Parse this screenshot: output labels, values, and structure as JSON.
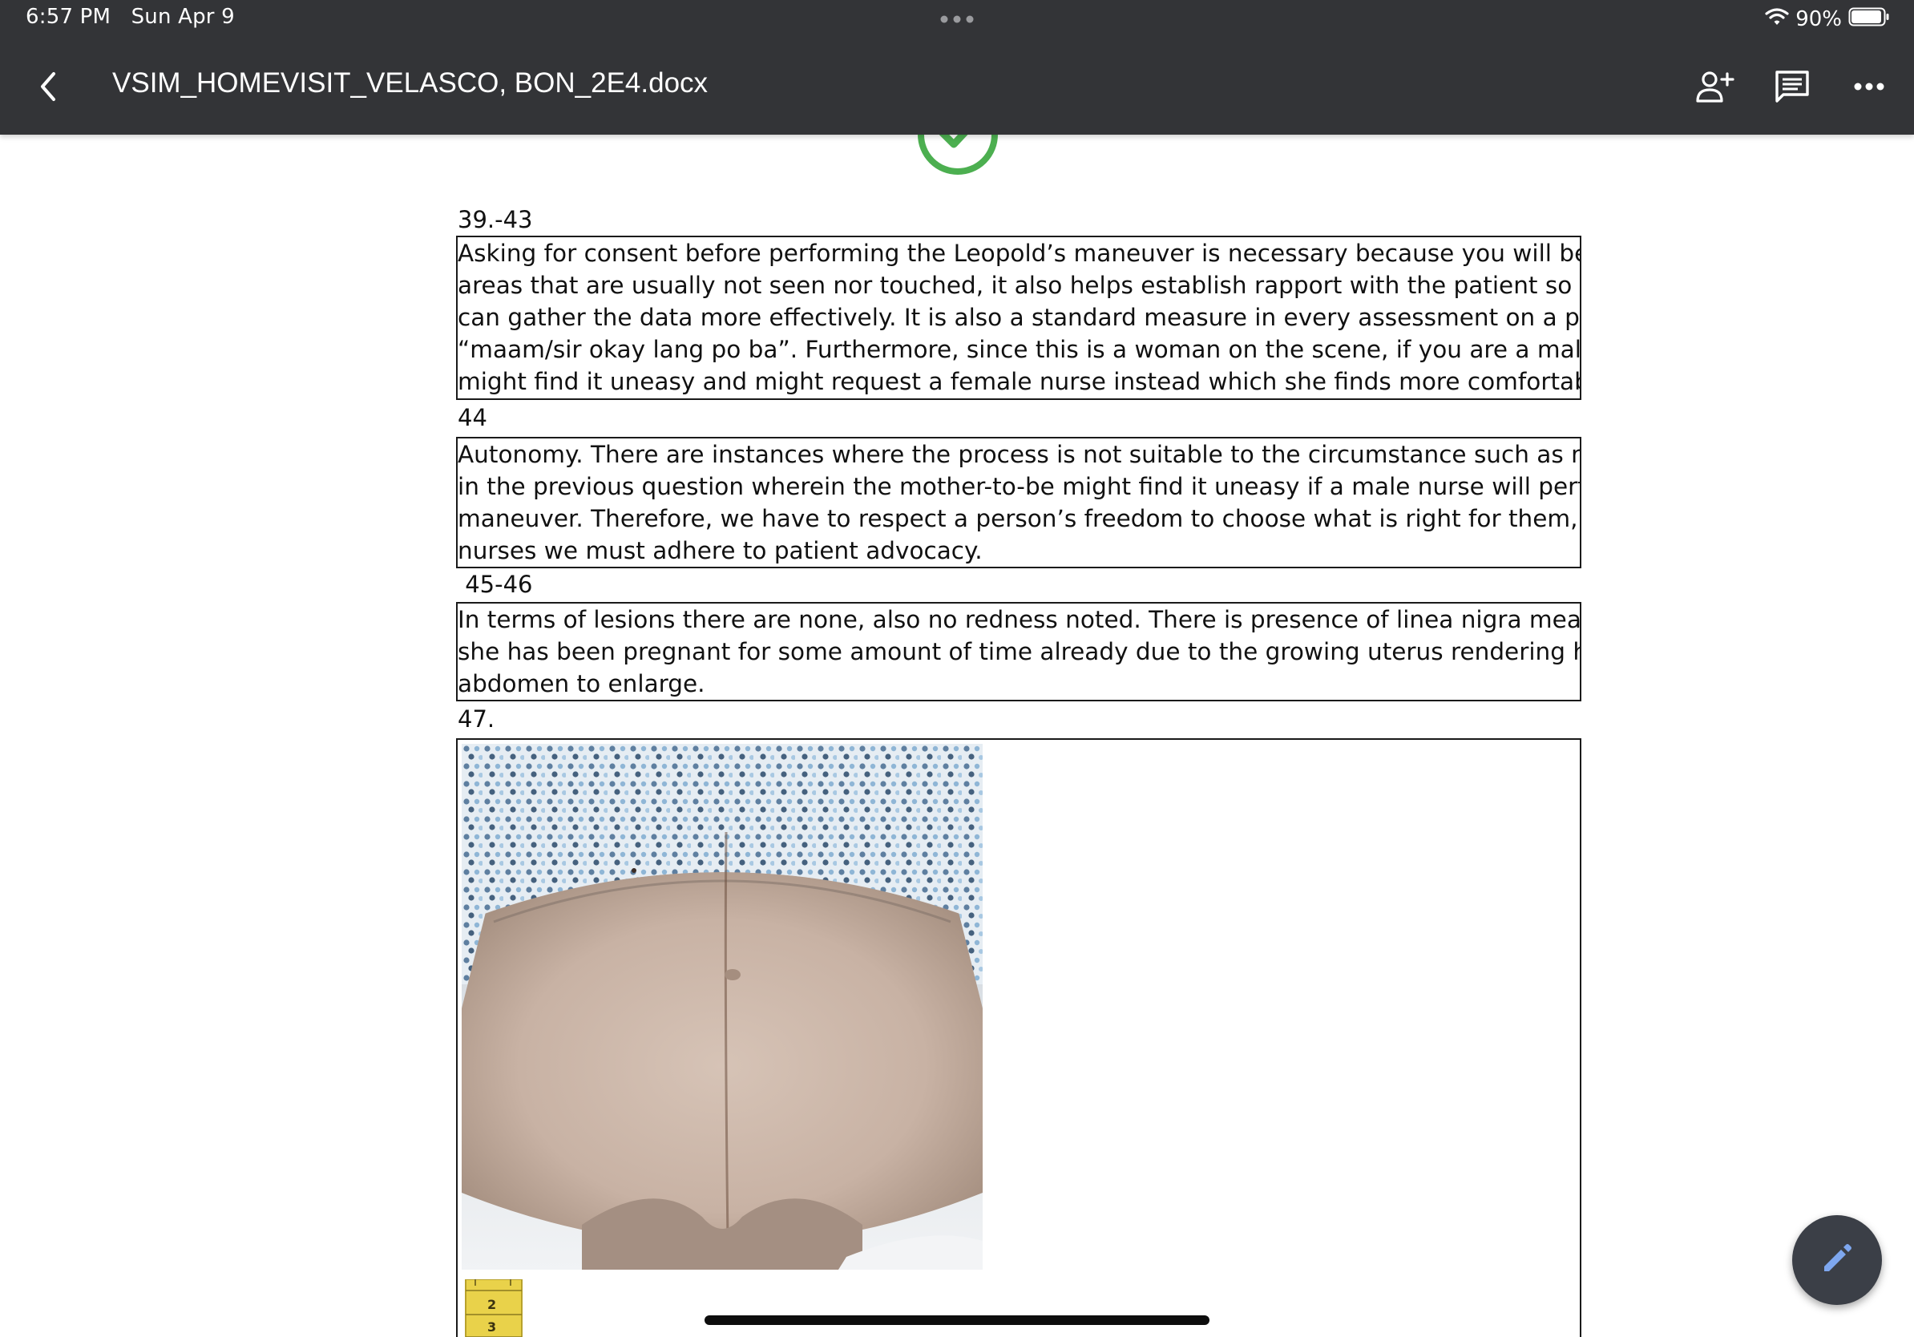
{
  "status_bar": {
    "time": "6:57 PM",
    "date": "Sun Apr 9",
    "battery": "90%",
    "multitask_icon": "more-dots-icon",
    "wifi_icon": "wifi-icon",
    "battery_icon": "battery-icon"
  },
  "toolbar": {
    "title": "VSIM_HOMEVISIT_VELASCO, BON_2E4.docx",
    "back_icon": "back-chevron-icon",
    "share_icon": "add-person-icon",
    "comment_icon": "comment-icon",
    "more_icon": "more-horizontal-icon",
    "background": "#333437"
  },
  "document": {
    "sections": [
      {
        "label": "39.-43",
        "lines": [
          "Asking for consent before performing the Leopold’s maneuver is necessary because you will be assessing",
          "areas that are usually not seen nor touched, it also helps establish rapport with the patient so that you",
          "can gather the data more effectively. It is also a standard measure in every assessment on a patient",
          "“maam/sir okay lang po ba”. Furthermore, since this is a woman on the scene, if you are a male, she",
          "might find it uneasy and might request a female nurse instead which she finds more comfortable."
        ]
      },
      {
        "label": "44",
        "lines": [
          "Autonomy. There are instances where the process is not suitable to the circumstance such as my answer",
          "in the previous question wherein the mother-to-be might find it uneasy if a male nurse will perform the",
          "maneuver. Therefore, we have to respect a person’s freedom to choose what is right for them, and as",
          "nurses we must adhere to patient advocacy."
        ]
      },
      {
        "label": " 45-46",
        "lines": [
          "In terms of lesions there are none, also no redness noted. There is presence of linea nigra meaning that",
          "she has been pregnant for some amount of time already due to the growing uterus rendering her",
          "abdomen to enlarge."
        ]
      }
    ],
    "image_section": {
      "label": "47.",
      "image_description_icon": "pregnant-abdomen-photo",
      "tape_icon": "measuring-tape-icon",
      "tape_marks": [
        "2",
        "3"
      ]
    }
  },
  "fab": {
    "icon": "edit-pencil-icon",
    "accent": "#7ea7ef"
  },
  "colors": {
    "check_green": "#4caf50"
  }
}
